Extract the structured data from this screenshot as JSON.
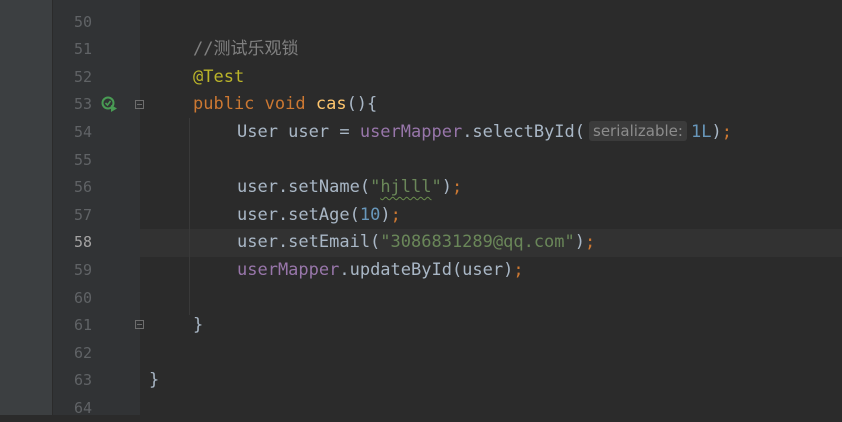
{
  "editor": {
    "lines": [
      {
        "n": "50",
        "tokens": []
      },
      {
        "n": "51",
        "tokens": [
          {
            "t": "//测试乐观锁",
            "c": "c-comment"
          }
        ]
      },
      {
        "n": "52",
        "tokens": [
          {
            "t": "@Test",
            "c": "c-annotation"
          }
        ]
      },
      {
        "n": "53",
        "tokens": [
          {
            "t": "public ",
            "c": "c-keyword"
          },
          {
            "t": "void ",
            "c": "c-keyword"
          },
          {
            "t": "cas",
            "c": "c-method"
          },
          {
            "t": "(){",
            "c": "c-plain"
          }
        ]
      },
      {
        "n": "54",
        "tokens": [
          {
            "t": "User user = ",
            "c": "c-plain"
          },
          {
            "t": "userMapper",
            "c": "c-field"
          },
          {
            "t": ".selectById(",
            "c": "c-plain"
          },
          {
            "hint": "serializable:"
          },
          {
            "t": "1L",
            "c": "c-number"
          },
          {
            "t": ")",
            "c": "c-plain"
          },
          {
            "t": ";",
            "c": "c-punct"
          }
        ]
      },
      {
        "n": "55",
        "tokens": []
      },
      {
        "n": "56",
        "tokens": [
          {
            "t": "user.setName(",
            "c": "c-plain"
          },
          {
            "t": "\"",
            "c": "c-string"
          },
          {
            "t": "hjlll",
            "c": "c-string typo"
          },
          {
            "t": "\"",
            "c": "c-string"
          },
          {
            "t": ")",
            "c": "c-plain"
          },
          {
            "t": ";",
            "c": "c-punct"
          }
        ]
      },
      {
        "n": "57",
        "tokens": [
          {
            "t": "user.setAge(",
            "c": "c-plain"
          },
          {
            "t": "10",
            "c": "c-number"
          },
          {
            "t": ")",
            "c": "c-plain"
          },
          {
            "t": ";",
            "c": "c-punct"
          }
        ]
      },
      {
        "n": "58",
        "tokens": [
          {
            "t": "user.setEmail(",
            "c": "c-plain"
          },
          {
            "t": "\"3086831289@qq.com\"",
            "c": "c-string"
          },
          {
            "t": ")",
            "c": "c-plain"
          },
          {
            "t": ";",
            "c": "c-punct"
          }
        ]
      },
      {
        "n": "59",
        "tokens": [
          {
            "t": "userMapper",
            "c": "c-field"
          },
          {
            "t": ".updateById(user)",
            "c": "c-plain"
          },
          {
            "t": ";",
            "c": "c-punct"
          }
        ]
      },
      {
        "n": "60",
        "tokens": []
      },
      {
        "n": "61",
        "tokens": [
          {
            "t": "}",
            "c": "c-plain"
          }
        ]
      },
      {
        "n": "62",
        "tokens": []
      },
      {
        "n": "63",
        "tokens": [
          {
            "t": "}",
            "c": "c-plain"
          }
        ]
      },
      {
        "n": "64",
        "tokens": []
      }
    ],
    "current_line": "58",
    "run_icon": "run-test-icon",
    "fold_icon": "fold-marker-icon"
  },
  "colors": {
    "background": "#2b2b2b",
    "gutter": "#313335",
    "comment": "#808080",
    "keyword": "#cc7832",
    "string": "#6a8759",
    "number": "#6897bb",
    "field": "#9876aa",
    "method": "#ffc66d",
    "annotation": "#bbb529"
  }
}
